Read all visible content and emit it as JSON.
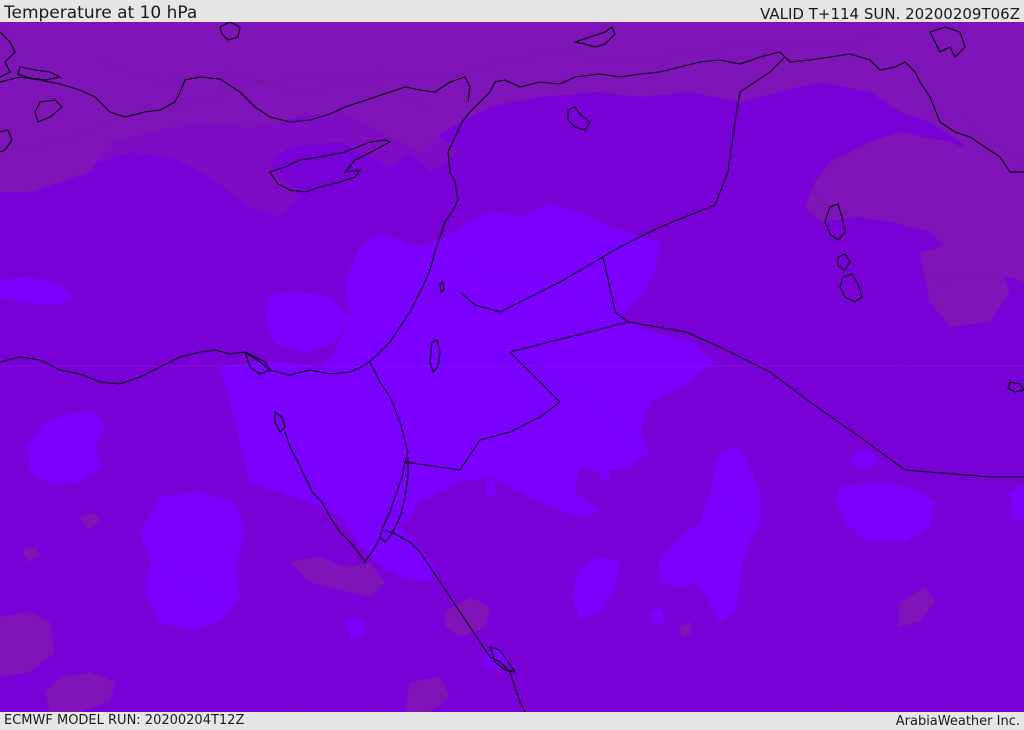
{
  "header": {
    "title": "Temperature at 10 hPa",
    "valid_time": "VALID T+114 SUN. 20200209T06Z"
  },
  "footer": {
    "model_run": "ECMWF MODEL RUN: 20200204T12Z",
    "credit": "ArabiaWeather Inc."
  },
  "colors": {
    "field_base": "#7a00d8",
    "field_cold_dark": "#7e14b8",
    "field_warm_light": "#7b00ff",
    "coastline": "#000000",
    "border_dotted": "#3a2a5a",
    "background": "#e6e6e6"
  }
}
